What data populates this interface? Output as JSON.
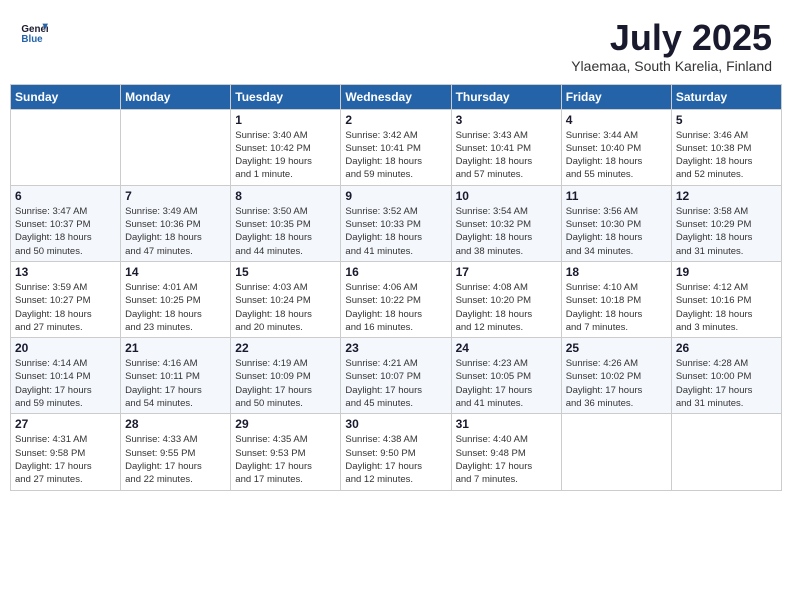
{
  "header": {
    "logo_line1": "General",
    "logo_line2": "Blue",
    "month_title": "July 2025",
    "subtitle": "Ylaemaa, South Karelia, Finland"
  },
  "weekdays": [
    "Sunday",
    "Monday",
    "Tuesday",
    "Wednesday",
    "Thursday",
    "Friday",
    "Saturday"
  ],
  "weeks": [
    [
      {
        "day": "",
        "info": ""
      },
      {
        "day": "",
        "info": ""
      },
      {
        "day": "1",
        "info": "Sunrise: 3:40 AM\nSunset: 10:42 PM\nDaylight: 19 hours\nand 1 minute."
      },
      {
        "day": "2",
        "info": "Sunrise: 3:42 AM\nSunset: 10:41 PM\nDaylight: 18 hours\nand 59 minutes."
      },
      {
        "day": "3",
        "info": "Sunrise: 3:43 AM\nSunset: 10:41 PM\nDaylight: 18 hours\nand 57 minutes."
      },
      {
        "day": "4",
        "info": "Sunrise: 3:44 AM\nSunset: 10:40 PM\nDaylight: 18 hours\nand 55 minutes."
      },
      {
        "day": "5",
        "info": "Sunrise: 3:46 AM\nSunset: 10:38 PM\nDaylight: 18 hours\nand 52 minutes."
      }
    ],
    [
      {
        "day": "6",
        "info": "Sunrise: 3:47 AM\nSunset: 10:37 PM\nDaylight: 18 hours\nand 50 minutes."
      },
      {
        "day": "7",
        "info": "Sunrise: 3:49 AM\nSunset: 10:36 PM\nDaylight: 18 hours\nand 47 minutes."
      },
      {
        "day": "8",
        "info": "Sunrise: 3:50 AM\nSunset: 10:35 PM\nDaylight: 18 hours\nand 44 minutes."
      },
      {
        "day": "9",
        "info": "Sunrise: 3:52 AM\nSunset: 10:33 PM\nDaylight: 18 hours\nand 41 minutes."
      },
      {
        "day": "10",
        "info": "Sunrise: 3:54 AM\nSunset: 10:32 PM\nDaylight: 18 hours\nand 38 minutes."
      },
      {
        "day": "11",
        "info": "Sunrise: 3:56 AM\nSunset: 10:30 PM\nDaylight: 18 hours\nand 34 minutes."
      },
      {
        "day": "12",
        "info": "Sunrise: 3:58 AM\nSunset: 10:29 PM\nDaylight: 18 hours\nand 31 minutes."
      }
    ],
    [
      {
        "day": "13",
        "info": "Sunrise: 3:59 AM\nSunset: 10:27 PM\nDaylight: 18 hours\nand 27 minutes."
      },
      {
        "day": "14",
        "info": "Sunrise: 4:01 AM\nSunset: 10:25 PM\nDaylight: 18 hours\nand 23 minutes."
      },
      {
        "day": "15",
        "info": "Sunrise: 4:03 AM\nSunset: 10:24 PM\nDaylight: 18 hours\nand 20 minutes."
      },
      {
        "day": "16",
        "info": "Sunrise: 4:06 AM\nSunset: 10:22 PM\nDaylight: 18 hours\nand 16 minutes."
      },
      {
        "day": "17",
        "info": "Sunrise: 4:08 AM\nSunset: 10:20 PM\nDaylight: 18 hours\nand 12 minutes."
      },
      {
        "day": "18",
        "info": "Sunrise: 4:10 AM\nSunset: 10:18 PM\nDaylight: 18 hours\nand 7 minutes."
      },
      {
        "day": "19",
        "info": "Sunrise: 4:12 AM\nSunset: 10:16 PM\nDaylight: 18 hours\nand 3 minutes."
      }
    ],
    [
      {
        "day": "20",
        "info": "Sunrise: 4:14 AM\nSunset: 10:14 PM\nDaylight: 17 hours\nand 59 minutes."
      },
      {
        "day": "21",
        "info": "Sunrise: 4:16 AM\nSunset: 10:11 PM\nDaylight: 17 hours\nand 54 minutes."
      },
      {
        "day": "22",
        "info": "Sunrise: 4:19 AM\nSunset: 10:09 PM\nDaylight: 17 hours\nand 50 minutes."
      },
      {
        "day": "23",
        "info": "Sunrise: 4:21 AM\nSunset: 10:07 PM\nDaylight: 17 hours\nand 45 minutes."
      },
      {
        "day": "24",
        "info": "Sunrise: 4:23 AM\nSunset: 10:05 PM\nDaylight: 17 hours\nand 41 minutes."
      },
      {
        "day": "25",
        "info": "Sunrise: 4:26 AM\nSunset: 10:02 PM\nDaylight: 17 hours\nand 36 minutes."
      },
      {
        "day": "26",
        "info": "Sunrise: 4:28 AM\nSunset: 10:00 PM\nDaylight: 17 hours\nand 31 minutes."
      }
    ],
    [
      {
        "day": "27",
        "info": "Sunrise: 4:31 AM\nSunset: 9:58 PM\nDaylight: 17 hours\nand 27 minutes."
      },
      {
        "day": "28",
        "info": "Sunrise: 4:33 AM\nSunset: 9:55 PM\nDaylight: 17 hours\nand 22 minutes."
      },
      {
        "day": "29",
        "info": "Sunrise: 4:35 AM\nSunset: 9:53 PM\nDaylight: 17 hours\nand 17 minutes."
      },
      {
        "day": "30",
        "info": "Sunrise: 4:38 AM\nSunset: 9:50 PM\nDaylight: 17 hours\nand 12 minutes."
      },
      {
        "day": "31",
        "info": "Sunrise: 4:40 AM\nSunset: 9:48 PM\nDaylight: 17 hours\nand 7 minutes."
      },
      {
        "day": "",
        "info": ""
      },
      {
        "day": "",
        "info": ""
      }
    ]
  ]
}
